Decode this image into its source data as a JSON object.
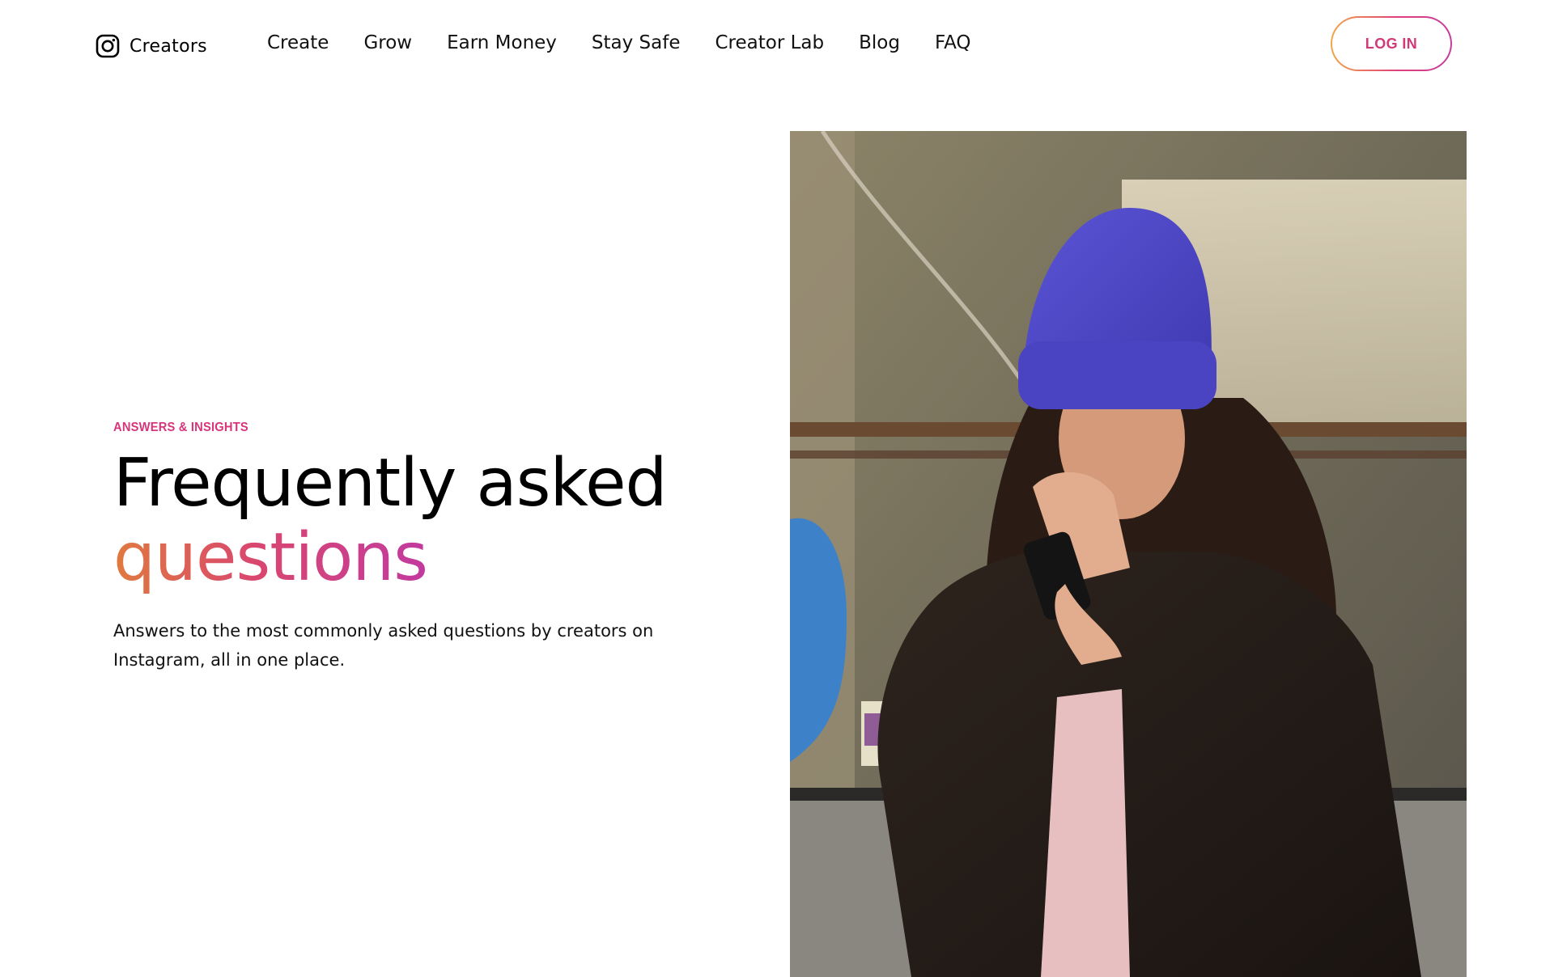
{
  "brand": {
    "label": "Creators",
    "icon": "instagram-icon"
  },
  "nav": {
    "items": [
      {
        "label": "Create"
      },
      {
        "label": "Grow"
      },
      {
        "label": "Earn Money"
      },
      {
        "label": "Stay Safe"
      },
      {
        "label": "Creator Lab"
      },
      {
        "label": "Blog"
      },
      {
        "label": "FAQ"
      }
    ],
    "login_label": "LOG IN"
  },
  "hero": {
    "eyebrow": "ANSWERS & INSIGHTS",
    "headline_line1": "Frequently asked",
    "headline_line2": "questions",
    "subtitle": "Answers to the most commonly asked questions by creators on Instagram, all in one place."
  },
  "colors": {
    "accent": "#d8357c",
    "gradient_start": "#f2a64a",
    "gradient_mid": "#e0407a",
    "gradient_end": "#c53c9d"
  }
}
